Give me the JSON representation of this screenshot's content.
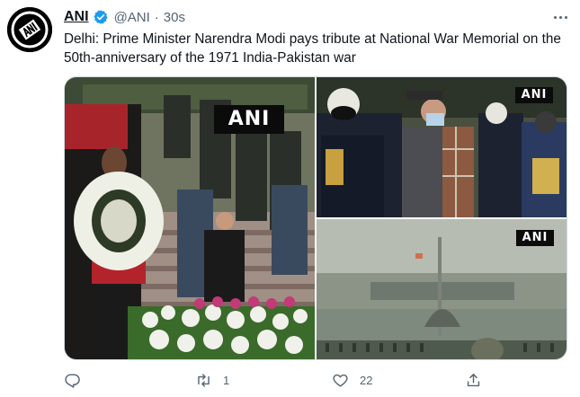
{
  "author": {
    "name": "ANI",
    "handle": "@ANI",
    "separator": "·",
    "time": "30s",
    "verified": true,
    "avatar_icon": "ani-logo-icon"
  },
  "tweet": {
    "text": "Delhi: Prime Minister Narendra Modi pays tribute at National War Memorial on the 50th-anniversary of the 1971 India-Pakistan war"
  },
  "media": {
    "watermarks": [
      "ANI",
      "ANI",
      "ANI"
    ]
  },
  "actions": {
    "reply_icon": "reply-icon",
    "reply_count": "",
    "retweet_icon": "retweet-icon",
    "retweet_count": "1",
    "like_icon": "heart-icon",
    "like_count": "22",
    "share_icon": "share-icon"
  },
  "colors": {
    "text": "#0f1419",
    "secondary": "#536471",
    "verified": "#1d9bf0"
  }
}
